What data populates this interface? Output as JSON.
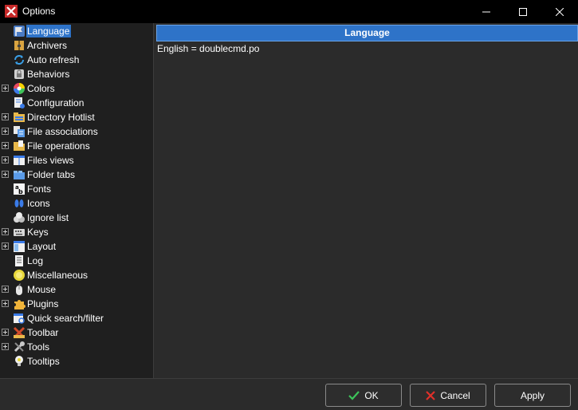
{
  "window": {
    "title": "Options"
  },
  "sidebar": {
    "items": [
      {
        "label": "Language",
        "icon": "flag-icon",
        "expandable": false,
        "selected": true
      },
      {
        "label": "Archivers",
        "icon": "archive-icon",
        "expandable": false
      },
      {
        "label": "Auto refresh",
        "icon": "refresh-icon",
        "expandable": false
      },
      {
        "label": "Behaviors",
        "icon": "lock-icon",
        "expandable": false
      },
      {
        "label": "Colors",
        "icon": "color-wheel-icon",
        "expandable": true
      },
      {
        "label": "Configuration",
        "icon": "config-icon",
        "expandable": false
      },
      {
        "label": "Directory Hotlist",
        "icon": "hotlist-icon",
        "expandable": true
      },
      {
        "label": "File associations",
        "icon": "file-assoc-icon",
        "expandable": true
      },
      {
        "label": "File operations",
        "icon": "file-ops-icon",
        "expandable": true
      },
      {
        "label": "Files views",
        "icon": "files-views-icon",
        "expandable": true
      },
      {
        "label": "Folder tabs",
        "icon": "folder-tabs-icon",
        "expandable": true
      },
      {
        "label": "Fonts",
        "icon": "fonts-icon",
        "expandable": false
      },
      {
        "label": "Icons",
        "icon": "icons-icon",
        "expandable": false
      },
      {
        "label": "Ignore list",
        "icon": "ignore-list-icon",
        "expandable": false
      },
      {
        "label": "Keys",
        "icon": "keyboard-icon",
        "expandable": true
      },
      {
        "label": "Layout",
        "icon": "layout-icon",
        "expandable": true
      },
      {
        "label": "Log",
        "icon": "log-icon",
        "expandable": false
      },
      {
        "label": "Miscellaneous",
        "icon": "misc-icon",
        "expandable": false
      },
      {
        "label": "Mouse",
        "icon": "mouse-icon",
        "expandable": true
      },
      {
        "label": "Plugins",
        "icon": "puzzle-icon",
        "expandable": true
      },
      {
        "label": "Quick search/filter",
        "icon": "search-filter-icon",
        "expandable": false
      },
      {
        "label": "Toolbar",
        "icon": "toolbar-icon",
        "expandable": true
      },
      {
        "label": "Tools",
        "icon": "tools-icon",
        "expandable": true
      },
      {
        "label": "Tooltips",
        "icon": "tooltip-icon",
        "expandable": false
      }
    ]
  },
  "main": {
    "header": "Language",
    "language_line": "English = doublecmd.po"
  },
  "footer": {
    "ok_label": "OK",
    "cancel_label": "Cancel",
    "apply_label": "Apply"
  },
  "colors": {
    "accent": "#2e73c8",
    "titlebar": "#000000",
    "sidebar_bg": "#1f1f1f",
    "panel_bg": "#2b2b2b"
  }
}
